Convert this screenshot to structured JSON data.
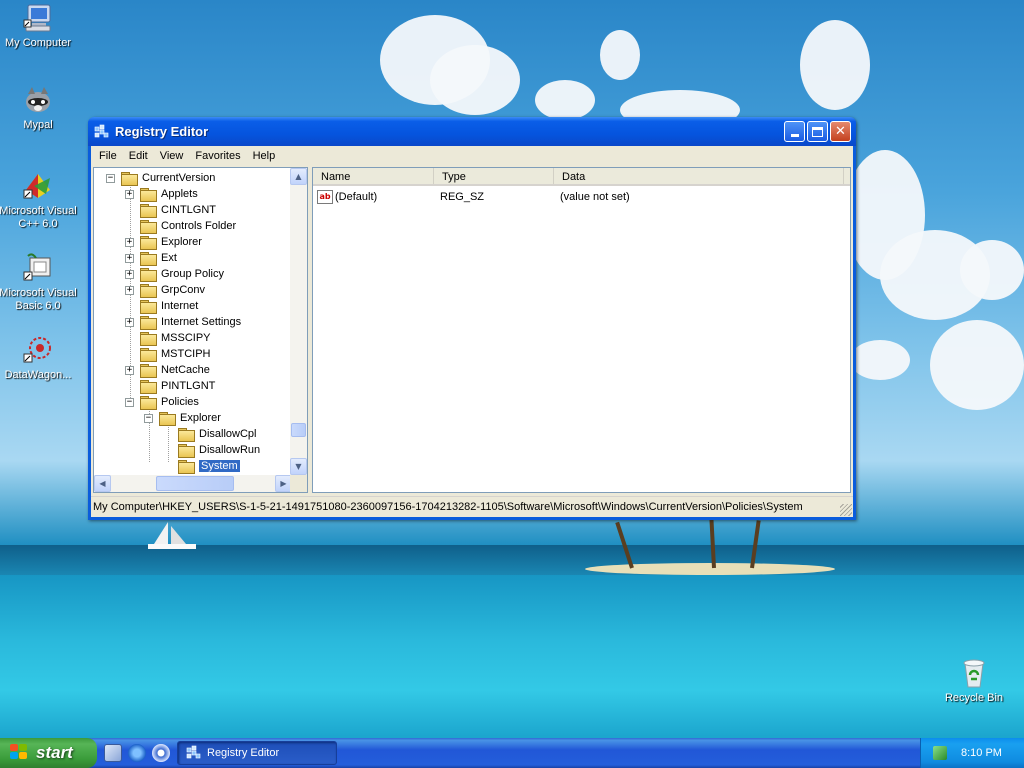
{
  "desktop": {
    "icons": [
      {
        "label": "My Computer",
        "icon": "my-computer-icon"
      },
      {
        "label": "Mypal",
        "icon": "mypal-raccoon-icon"
      },
      {
        "label": "Microsoft Visual C++ 6.0",
        "icon": "visual-cpp-icon"
      },
      {
        "label": "Microsoft Visual Basic 6.0",
        "icon": "visual-basic-icon"
      },
      {
        "label": "DataWagon...",
        "icon": "datawagon-icon"
      },
      {
        "label": "Recycle Bin",
        "icon": "recycle-bin-icon"
      }
    ]
  },
  "window": {
    "title": "Registry Editor",
    "buttons": {
      "minimize": "minimize-icon",
      "maximize": "maximize-icon",
      "close": "close-icon"
    },
    "menu": [
      "File",
      "Edit",
      "View",
      "Favorites",
      "Help"
    ],
    "tree": [
      {
        "label": "CurrentVersion",
        "expander": "−"
      },
      {
        "label": "Applets",
        "expander": "+"
      },
      {
        "label": "CINTLGNT",
        "expander": ""
      },
      {
        "label": "Controls Folder",
        "expander": ""
      },
      {
        "label": "Explorer",
        "expander": "+"
      },
      {
        "label": "Ext",
        "expander": "+"
      },
      {
        "label": "Group Policy",
        "expander": "+"
      },
      {
        "label": "GrpConv",
        "expander": "+"
      },
      {
        "label": "Internet",
        "expander": ""
      },
      {
        "label": "Internet Settings",
        "expander": "+"
      },
      {
        "label": "MSSCIPY",
        "expander": ""
      },
      {
        "label": "MSTCIPH",
        "expander": ""
      },
      {
        "label": "NetCache",
        "expander": "+"
      },
      {
        "label": "PINTLGNT",
        "expander": ""
      },
      {
        "label": "Policies",
        "expander": "−"
      },
      {
        "label": "Explorer",
        "expander": "−"
      },
      {
        "label": "DisallowCpl",
        "expander": ""
      },
      {
        "label": "DisallowRun",
        "expander": ""
      },
      {
        "label": "System",
        "expander": ""
      }
    ],
    "selected_tree_item": "System",
    "list_columns": [
      "Name",
      "Type",
      "Data"
    ],
    "list_rows": [
      {
        "name": "(Default)",
        "type": "REG_SZ",
        "data": "(value not set)",
        "icon": "string-value-ab-icon"
      }
    ],
    "status_path": "My Computer\\HKEY_USERS\\S-1-5-21-1491751080-2360097156-1704213282-1105\\Software\\Microsoft\\Windows\\CurrentVersion\\Policies\\System"
  },
  "taskbar": {
    "start_label": "start",
    "quick_launch": [
      "show-desktop-icon",
      "internet-explorer-icon",
      "media-player-icon"
    ],
    "task_button": "Registry Editor",
    "tray_icon": "network-tray-icon",
    "clock": "8:10 PM"
  },
  "colors": {
    "titlebar": "#0a5ee8",
    "start_button": "#3a9c3a",
    "selection": "#316ac5"
  }
}
